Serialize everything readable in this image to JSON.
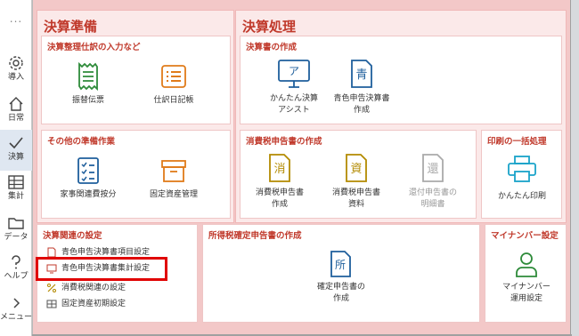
{
  "sidebar": {
    "dots": "...",
    "items": [
      {
        "label": "導入",
        "icon": "gear-icon"
      },
      {
        "label": "日常",
        "icon": "home-icon"
      },
      {
        "label": "決算",
        "icon": "checkmark-icon",
        "active": true
      },
      {
        "label": "集計",
        "icon": "table-icon"
      },
      {
        "label": "データ",
        "icon": "folder-icon"
      },
      {
        "label": "ヘルプ",
        "icon": "question-icon"
      },
      {
        "label": "メニュー",
        "icon": "chevron-right-icon"
      }
    ]
  },
  "prep": {
    "title": "決算準備",
    "adjust": {
      "title": "決算整理仕訳の入力など",
      "items": [
        {
          "label": "振替伝票",
          "icon": "receipt-icon"
        },
        {
          "label": "仕訳日記帳",
          "icon": "list-icon"
        }
      ]
    },
    "other": {
      "title": "その他の準備作業",
      "items": [
        {
          "label": "家事関連費按分",
          "icon": "checklist-icon"
        },
        {
          "label": "固定資産管理",
          "icon": "box-icon"
        }
      ]
    }
  },
  "process": {
    "title": "決算処理",
    "docs": {
      "title": "決算書の作成",
      "items": [
        {
          "label1": "かんたん決算",
          "label2": "アシスト",
          "icon": "monitor-icon",
          "glyph": "ア"
        },
        {
          "label1": "青色申告決算書",
          "label2": "作成",
          "icon": "document-icon",
          "glyph": "青"
        }
      ]
    },
    "tax": {
      "title": "消費税申告書の作成",
      "items": [
        {
          "label1": "消費税申告書",
          "label2": "作成",
          "glyph": "消"
        },
        {
          "label1": "消費税申告書",
          "label2": "資料",
          "glyph": "資"
        },
        {
          "label1": "還付申告書の",
          "label2": "明細書",
          "glyph": "還",
          "disabled": true
        }
      ]
    },
    "print": {
      "title": "印刷の一括処理",
      "item": {
        "label": "かんたん印刷",
        "icon": "printer-icon"
      }
    }
  },
  "settings": {
    "title": "決算関連の設定",
    "items": [
      {
        "label": "青色申告決算書項目設定",
        "icon": "document-edit-icon"
      },
      {
        "label": "青色申告決算書集計設定",
        "icon": "monitor-small-icon"
      },
      {
        "label": "消費税関連の設定",
        "icon": "percent-icon"
      },
      {
        "label": "固定資産初期設定",
        "icon": "grid-icon"
      }
    ]
  },
  "income": {
    "title": "所得税確定申告書の作成",
    "item": {
      "label1": "確定申告書の",
      "label2": "作成",
      "glyph": "所"
    }
  },
  "mynumber": {
    "title": "マイナンバー設定",
    "item": {
      "label1": "マイナンバー",
      "label2": "運用設定",
      "icon": "person-icon"
    }
  },
  "colors": {
    "accent": "#c0392b",
    "icon_blue": "#1f5f9c",
    "icon_orange": "#e07b1a",
    "icon_green": "#2e8b3a",
    "highlight": "#e00000"
  }
}
